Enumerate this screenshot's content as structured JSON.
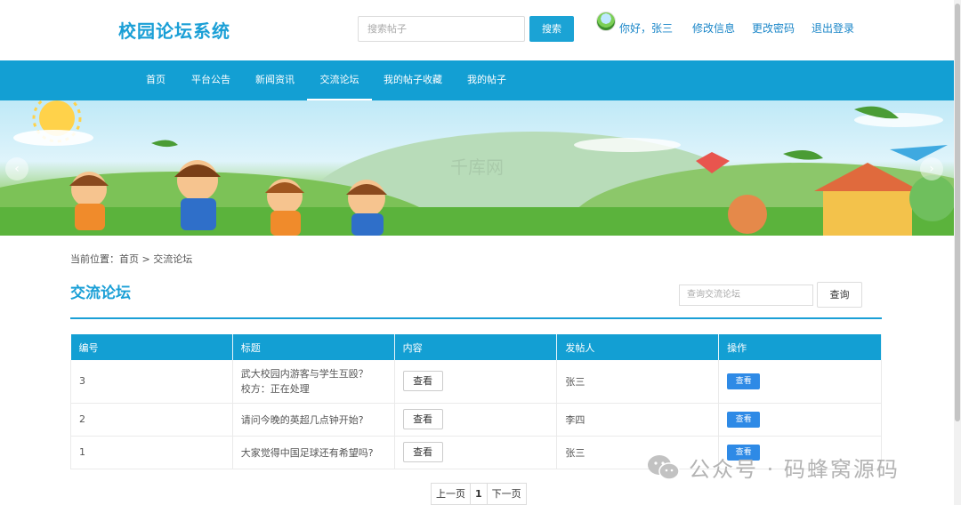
{
  "header": {
    "logo": "校园论坛系统",
    "search_placeholder": "搜索帖子",
    "search_button": "搜索",
    "greeting": "你好，张三",
    "links": [
      "修改信息",
      "更改密码",
      "退出登录"
    ]
  },
  "nav": {
    "items": [
      "首页",
      "平台公告",
      "新闻资讯",
      "交流论坛",
      "我的帖子收藏",
      "我的帖子"
    ],
    "active": "交流论坛"
  },
  "banner": {
    "watermark_text": "千库网"
  },
  "breadcrumb": "当前位置：首页 > 交流论坛",
  "section": {
    "title": "交流论坛",
    "query_placeholder": "查询交流论坛",
    "query_button": "查询"
  },
  "table": {
    "headers": [
      "编号",
      "标题",
      "内容",
      "发帖人",
      "操作"
    ],
    "rows": [
      {
        "id": "3",
        "title": "武大校园内游客与学生互殴？校方：正在处理",
        "content_button": "查看",
        "author": "张三",
        "op_button": "查看"
      },
      {
        "id": "2",
        "title": "请问今晚的英超几点钟开始?",
        "content_button": "查看",
        "author": "李四",
        "op_button": "查看"
      },
      {
        "id": "1",
        "title": "大家觉得中国足球还有希望吗?",
        "content_button": "查看",
        "author": "张三",
        "op_button": "查看"
      }
    ]
  },
  "pagination": {
    "prev": "上一页",
    "current": "1",
    "next": "下一页"
  },
  "watermark": "公众号 · 码蜂窝源码",
  "colors": {
    "brand": "#1a9fd6",
    "nav_bg": "#139fd3",
    "op_button": "#2e8ae6"
  }
}
